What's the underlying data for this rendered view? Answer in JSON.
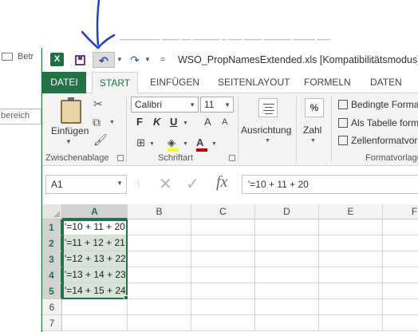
{
  "background_window": {
    "strip_text": "_________  ____  __  ______  _  ___  ____  ______  _____  ___",
    "left_text": "Betr",
    "search_placeholder": "bereich"
  },
  "titlebar": {
    "title": "WSO_PropNamesExtended.xls  [Kompatibilitätsmodus]  -  E",
    "undo_glyph": "↶",
    "redo_glyph": "↷",
    "customize_glyph": "="
  },
  "tabs": [
    {
      "label": "DATEI"
    },
    {
      "label": "START"
    },
    {
      "label": "EINFÜGEN"
    },
    {
      "label": "SEITENLAYOUT"
    },
    {
      "label": "FORMELN"
    },
    {
      "label": "DATEN"
    }
  ],
  "ribbon": {
    "clipboard": {
      "paste_label": "Einfügen",
      "group_label": "Zwischenablage"
    },
    "font": {
      "font_name": "Calibri",
      "font_size": "11",
      "bold": "F",
      "italic": "K",
      "underline": "U",
      "grow": "A",
      "shrink": "A",
      "font_color_glyph": "A",
      "group_label": "Schriftart"
    },
    "alignment": {
      "label": "Ausrichtung"
    },
    "number": {
      "label": "Zahl",
      "glyph": "%"
    },
    "styles": {
      "items": [
        "Bedingte Formatierung",
        "Als Tabelle formatieren",
        "Zellenformatvorlagen"
      ],
      "group_label": "Formatvorlagen"
    }
  },
  "formula_bar": {
    "name_box": "A1",
    "fx_label": "fx",
    "cancel_glyph": "✕",
    "enter_glyph": "✓",
    "formula": "'=10 + 11 + 20"
  },
  "grid": {
    "columns": [
      "A",
      "B",
      "C",
      "D",
      "E",
      "F"
    ],
    "rows": [
      "1",
      "2",
      "3",
      "4",
      "5",
      "6",
      "7"
    ],
    "cells_A": [
      "'=10 + 11 + 20",
      "'=11 + 12 + 21",
      "'=12 + 13 + 22",
      "'=13 + 14 + 23",
      "'=14 + 15 + 24",
      "",
      ""
    ]
  },
  "colors": {
    "accent": "#217346",
    "annotation": "#1f3fd1"
  }
}
